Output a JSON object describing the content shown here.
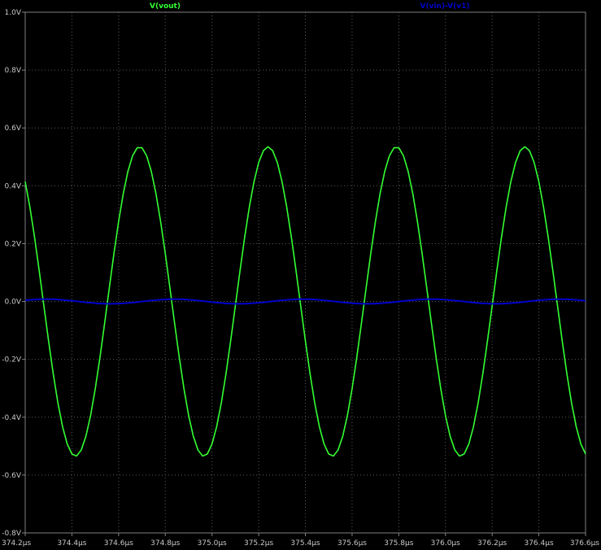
{
  "colors": {
    "background": "#000000",
    "frame": "#808080",
    "grid": "#5a5a5a",
    "tick_text": "#c8c8c8",
    "vout": "#33ff33",
    "vin_v1": "#0000cc"
  },
  "chart_data": {
    "type": "line",
    "title": "",
    "xlabel": "",
    "ylabel": "",
    "xlim": [
      374.2,
      376.6
    ],
    "ylim": [
      -0.8,
      1.0
    ],
    "x_unit": "µs",
    "grid": true,
    "grid_style": "dotted",
    "legend_position": "top",
    "x_tick_labels": [
      "374.2µs",
      "374.4µs",
      "374.6µs",
      "374.8µs",
      "375.0µs",
      "375.2µs",
      "375.4µs",
      "375.6µs",
      "375.8µs",
      "376.0µs",
      "376.2µs",
      "376.4µs",
      "376.6µs"
    ],
    "y_tick_labels": [
      "1.0V",
      "0.8V",
      "0.6V",
      "0.4V",
      "0.2V",
      "0.0V",
      "-0.2V",
      "-0.4V",
      "-0.6V",
      "-0.8V"
    ],
    "x_ticks": [
      374.2,
      374.4,
      374.6,
      374.8,
      375.0,
      375.2,
      375.4,
      375.6,
      375.8,
      376.0,
      376.2,
      376.4,
      376.6
    ],
    "y_ticks": [
      1.0,
      0.8,
      0.6,
      0.4,
      0.2,
      0.0,
      -0.2,
      -0.4,
      -0.6,
      -0.8
    ],
    "series": [
      {
        "name": "V(vout)",
        "color": "#33ff33",
        "amplitude": 0.535,
        "period": 0.55,
        "peak_at": 374.69,
        "sample_step": 0.02,
        "x": [
          374.2,
          374.69,
          374.965,
          375.24,
          375.515,
          375.79,
          376.065,
          376.34,
          376.6
        ],
        "y": [
          0.4,
          0.535,
          -0.535,
          0.535,
          -0.535,
          0.535,
          -0.535,
          0.535,
          -0.53
        ]
      },
      {
        "name": "V(vin)-V(v1)",
        "color": "#0000cc",
        "amplitude": 0.008,
        "period": 0.55,
        "peak_at": 374.84,
        "sample_step": 0.01,
        "x": [
          374.2,
          374.84,
          375.115,
          375.39,
          375.665,
          375.94,
          376.215,
          376.49,
          376.6
        ],
        "y": [
          0.0,
          0.008,
          -0.008,
          0.008,
          -0.008,
          0.008,
          -0.008,
          0.008,
          0.005
        ]
      }
    ]
  }
}
